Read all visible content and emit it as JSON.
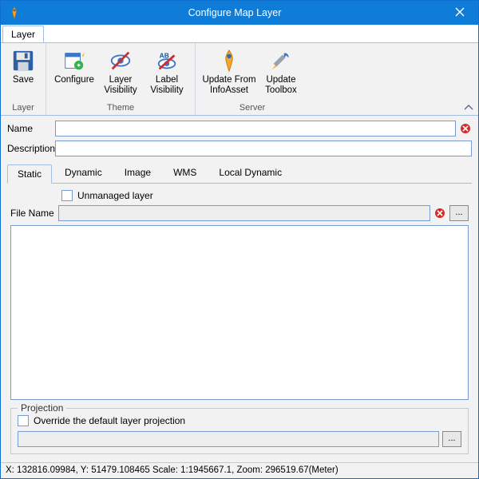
{
  "title": "Configure Map Layer",
  "ribbon": {
    "tab": "Layer",
    "groups": {
      "layer": {
        "label": "Layer",
        "save": "Save"
      },
      "theme": {
        "label": "Theme",
        "configure": "Configure",
        "layerVis": "Layer\nVisibility",
        "labelVis": "Label\nVisibility"
      },
      "server": {
        "label": "Server",
        "updateInfo": "Update From\nInfoAsset",
        "updateToolbox": "Update\nToolbox"
      }
    }
  },
  "fields": {
    "nameLabel": "Name",
    "nameValue": "",
    "descLabel": "Description",
    "descValue": "",
    "fileLabel": "File Name",
    "fileValue": "",
    "unmanaged": "Unmanaged layer"
  },
  "tabs": {
    "static": "Static",
    "dynamic": "Dynamic",
    "image": "Image",
    "wms": "WMS",
    "localDynamic": "Local Dynamic"
  },
  "projection": {
    "title": "Projection",
    "override": "Override the default layer projection"
  },
  "browse": "...",
  "status": "X: 132816.09984, Y: 51479.108465     Scale: 1:1945667.1, Zoom: 296519.67(Meter)"
}
